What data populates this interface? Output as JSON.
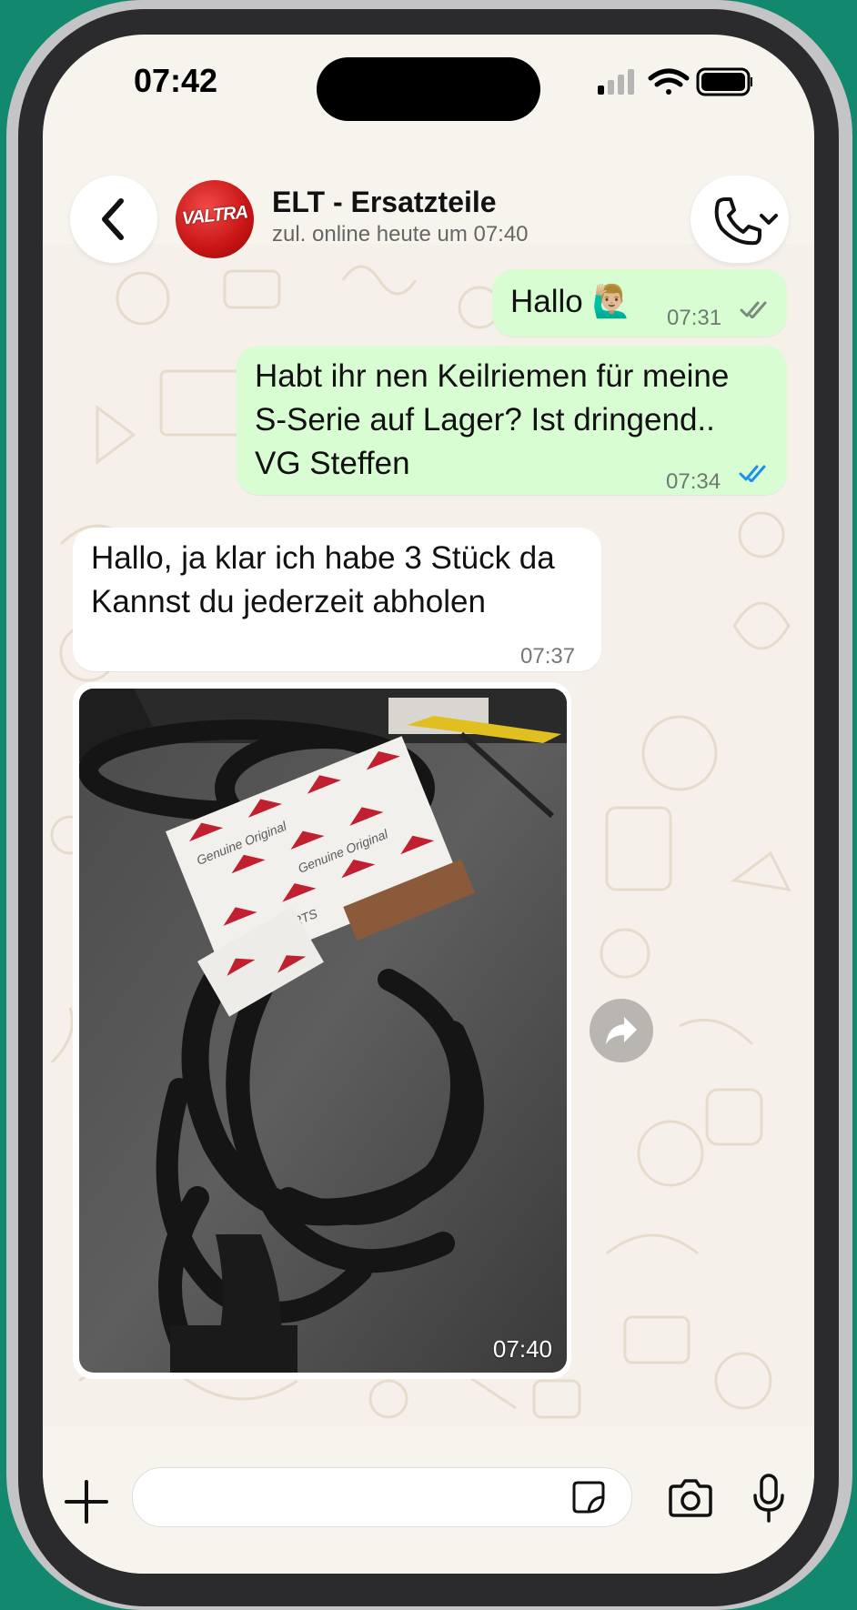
{
  "status_bar": {
    "time": "07:42"
  },
  "header": {
    "contact_name": "ELT - Ersatzteile",
    "contact_status": "zul. online heute um 07:40",
    "avatar_text": "VALTRA"
  },
  "messages": [
    {
      "direction": "outgoing",
      "text": "Hallo 🙋🏼‍♂️",
      "time": "07:31",
      "status": "delivered"
    },
    {
      "direction": "outgoing",
      "lines": [
        "Habt ihr nen Keilriemen für meine",
        "S-Serie auf Lager? Ist dringend..",
        "VG Steffen"
      ],
      "time": "07:34",
      "status": "read"
    },
    {
      "direction": "incoming",
      "lines": [
        "Hallo, ja klar ich habe 3 Stück da",
        "Kannst du jederzeit abholen"
      ],
      "time": "07:37"
    },
    {
      "direction": "incoming",
      "type": "image",
      "time": "07:40",
      "image_label": "Genuine Original AGCO Parts"
    }
  ],
  "colors": {
    "outgoing_bubble": "#d9fdd3",
    "incoming_bubble": "#ffffff",
    "read_tick": "#1d8ff2",
    "background": "#f5f1ea"
  },
  "icons": [
    "back-chevron-icon",
    "phone-icon",
    "chevron-down-icon",
    "double-check-icon",
    "forward-icon",
    "plus-icon",
    "sticker-icon",
    "camera-icon",
    "microphone-icon",
    "signal-icon",
    "wifi-icon",
    "battery-icon"
  ]
}
